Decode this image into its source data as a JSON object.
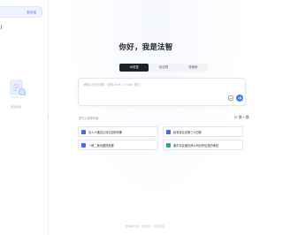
{
  "sidebar": {
    "new_chat_label": "新对话",
    "top_glyph": "J",
    "empty_text": "暂无对话",
    "collapse_glyph": "‹"
  },
  "main": {
    "greeting": "你好，我是法智",
    "tabs": [
      {
        "label": "AI问答",
        "active": true
      },
      {
        "label": "找法规",
        "active": false
      },
      {
        "label": "查案例",
        "active": false
      }
    ],
    "input": {
      "placeholder": "请输入您的问题，使用 Shift + Enter 换行"
    },
    "quick_section_label": "您可以这样问我",
    "refresh_label": "换一换",
    "questions": [
      {
        "text": "法人人格否认诉讼如何判断"
      },
      {
        "text": "民事诉讼法第三十四条"
      },
      {
        "text": "一房二卖问题的处理"
      },
      {
        "text": "股东未实缴出资公司对外债务的承担"
      }
    ],
    "footer": "内容由AI生成，仅供参考，请注意甄别。"
  },
  "colors": {
    "accent": "#3b82f6",
    "active_tab": "#1d2129",
    "question_icon_blue": "#3b6cf6",
    "question_icon_green": "#20b26c"
  }
}
